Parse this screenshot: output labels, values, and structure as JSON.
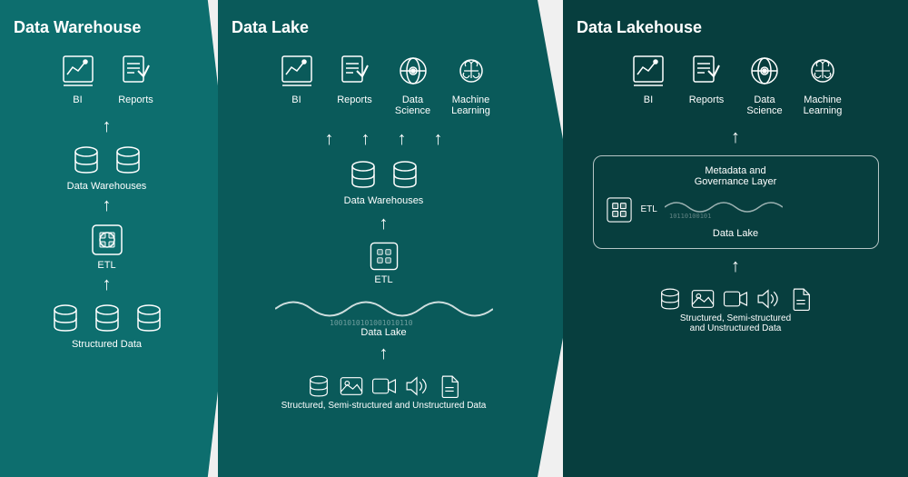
{
  "sections": [
    {
      "id": "warehouse",
      "title": "Data Warehouse",
      "icons_row": [
        {
          "id": "bi",
          "label": "BI"
        },
        {
          "id": "reports",
          "label": "Reports"
        }
      ],
      "middle_label": "Data Warehouses",
      "etl_label": "ETL",
      "bottom_label": "Structured Data"
    },
    {
      "id": "lake",
      "title": "Data Lake",
      "icons_row": [
        {
          "id": "bi",
          "label": "BI"
        },
        {
          "id": "reports",
          "label": "Reports"
        },
        {
          "id": "data-science",
          "label": "Data\nScience"
        },
        {
          "id": "machine-learning",
          "label": "Machine\nLearning"
        }
      ],
      "middle_label": "Data Warehouses",
      "etl_label": "ETL",
      "lake_label": "Data Lake",
      "bottom_label": "Structured, Semi-structured and Unstructured Data"
    },
    {
      "id": "lakehouse",
      "title": "Data Lakehouse",
      "icons_row": [
        {
          "id": "bi",
          "label": "BI"
        },
        {
          "id": "reports",
          "label": "Reports"
        },
        {
          "id": "data-science",
          "label": "Data\nScience"
        },
        {
          "id": "machine-learning",
          "label": "Machine\nLearning"
        }
      ],
      "governance_label": "Metadata and\nGovernance Layer",
      "etl_label": "ETL",
      "lake_label": "Data Lake",
      "bottom_label": "Structured, Semi-structured\nand Unstructured Data"
    }
  ],
  "colors": {
    "warehouse_bg": "#0d7070",
    "lake_bg": "#0a5c5c",
    "lakehouse_bg": "#074040",
    "white": "#ffffff"
  }
}
